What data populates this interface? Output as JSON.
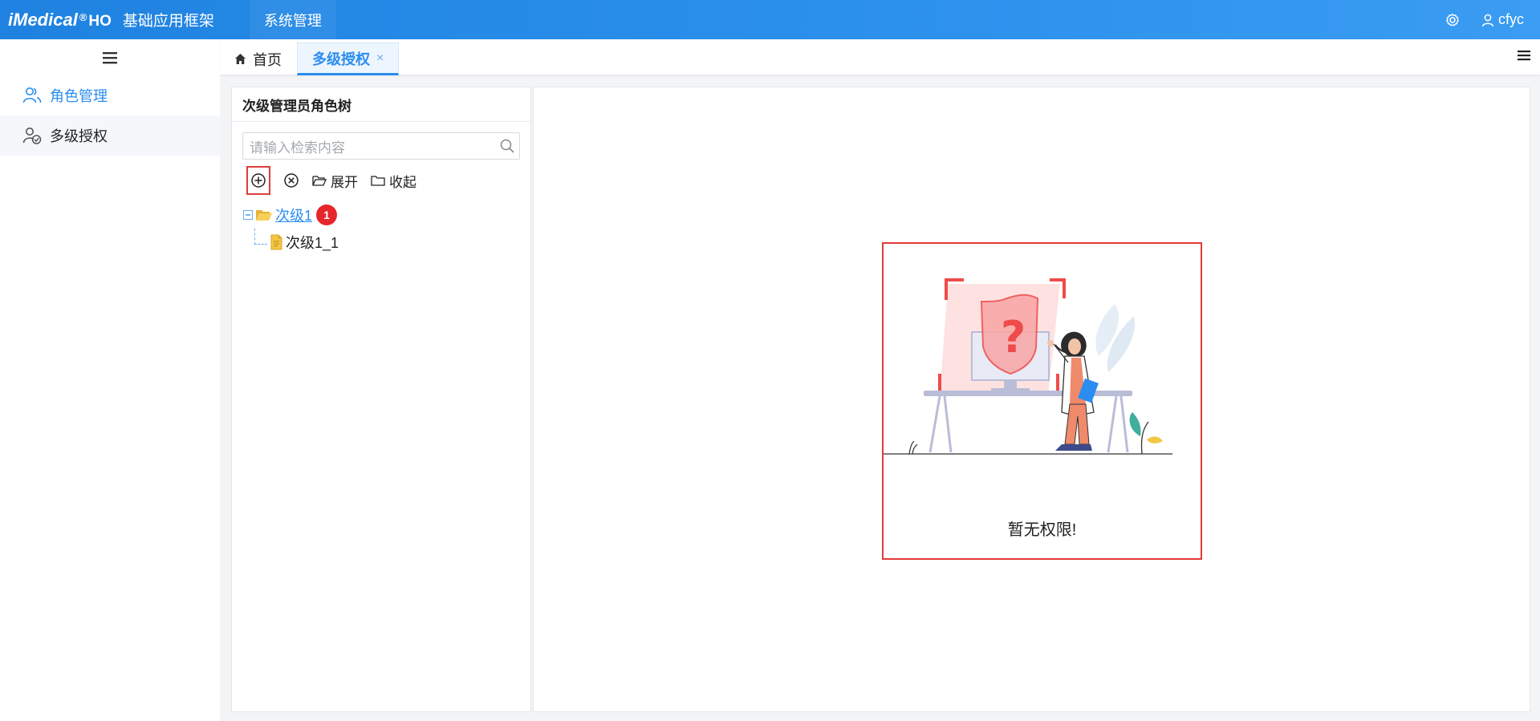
{
  "header": {
    "brand": "iMedical",
    "reg": "®",
    "suffix": "HO",
    "app_title": "基础应用框架",
    "nav_item": "系统管理",
    "user": "cfyc"
  },
  "sidebar": {
    "items": [
      {
        "label": "角色管理",
        "icon": "users-icon",
        "active": true
      },
      {
        "label": "多级授权",
        "icon": "user-check-icon",
        "active": false
      }
    ]
  },
  "tabs": {
    "home": "首页",
    "active": "多级授权",
    "close": "×"
  },
  "panel": {
    "title": "次级管理员角色树",
    "search_placeholder": "请输入检索内容",
    "toolbar": {
      "expand": "展开",
      "collapse": "收起"
    },
    "tree": {
      "root": "次级1",
      "badge": "1",
      "child": "次级1_1"
    }
  },
  "main": {
    "message": "暂无权限!"
  },
  "colors": {
    "primary": "#2b8df0",
    "topbar": "#2b90ec",
    "highlight": "#e23b3b"
  }
}
